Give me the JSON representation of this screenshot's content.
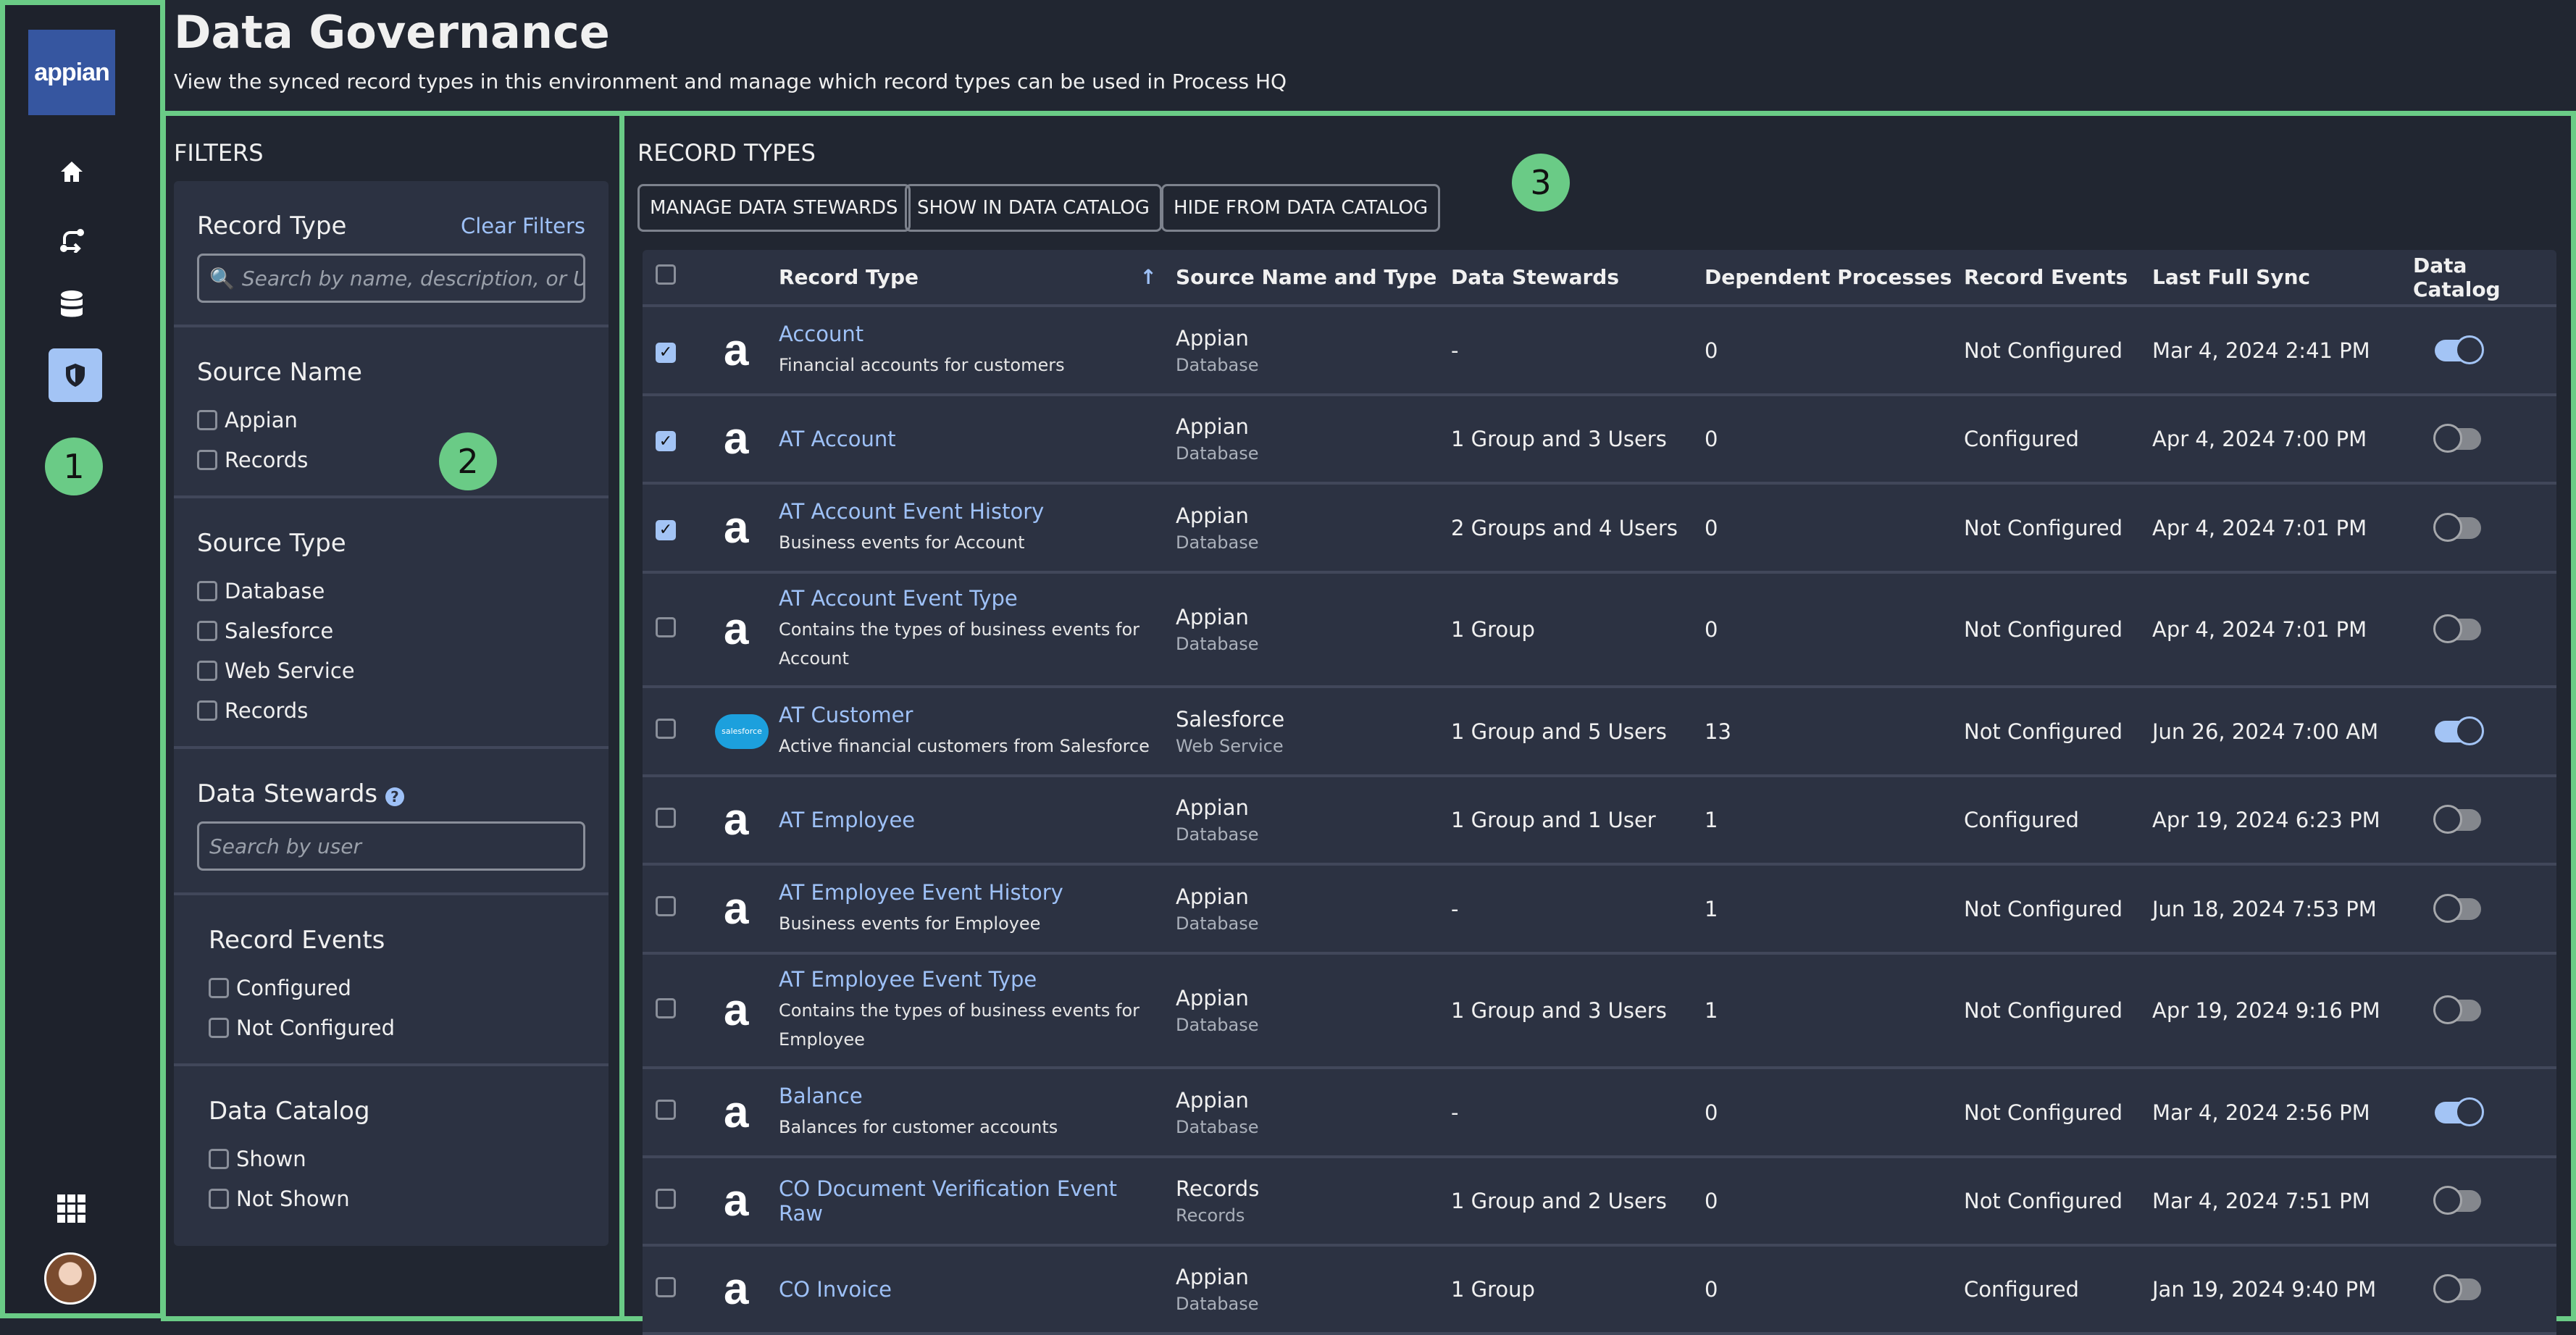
{
  "app": {
    "logo_text": "appian"
  },
  "header": {
    "title": "Data Governance",
    "subtitle": "View the synced record types in this environment and manage which record types can be used in Process HQ"
  },
  "annotations": [
    "1",
    "2",
    "3"
  ],
  "nav": {
    "items": [
      {
        "icon": "home-icon"
      },
      {
        "icon": "process-flow-icon"
      },
      {
        "icon": "database-icon"
      },
      {
        "icon": "shield-icon",
        "active": true
      }
    ],
    "bottom": [
      {
        "icon": "apps-grid-icon"
      },
      {
        "icon": "user-avatar"
      }
    ]
  },
  "filters": {
    "heading": "FILTERS",
    "record_type": {
      "label": "Record Type",
      "clear": "Clear Filters",
      "placeholder": "Search by name, description, or UUID"
    },
    "source_name": {
      "label": "Source Name",
      "options": [
        "Appian",
        "Records"
      ]
    },
    "source_type": {
      "label": "Source Type",
      "options": [
        "Database",
        "Salesforce",
        "Web Service",
        "Records"
      ]
    },
    "data_stewards": {
      "label": "Data Stewards",
      "help": "?",
      "placeholder": "Search by user"
    },
    "record_events": {
      "label": "Record Events",
      "options": [
        "Configured",
        "Not Configured"
      ]
    },
    "data_catalog": {
      "label": "Data Catalog",
      "options": [
        "Shown",
        "Not Shown"
      ]
    }
  },
  "records": {
    "heading": "RECORD TYPES",
    "buttons": [
      "MANAGE DATA STEWARDS",
      "SHOW IN DATA CATALOG",
      "HIDE FROM DATA CATALOG"
    ],
    "columns": [
      "Record Type",
      "Source Name and Type",
      "Data Stewards",
      "Dependent Processes",
      "Record Events",
      "Last Full Sync",
      "Data Catalog"
    ],
    "sort": "ascending",
    "colors": {
      "link": "#9ec1f7",
      "accent": "#a3c4f5",
      "frame": "#6acb86"
    },
    "rows": [
      {
        "selected": true,
        "icon": "appian",
        "name": "Account",
        "description": "Financial accounts for customers",
        "source_name": "Appian",
        "source_type": "Database",
        "stewards": "-",
        "dependent": "0",
        "events": "Not Configured",
        "last_sync": "Mar 4, 2024 2:41 PM",
        "catalog": true
      },
      {
        "selected": true,
        "icon": "appian",
        "name": "AT Account",
        "description": "",
        "source_name": "Appian",
        "source_type": "Database",
        "stewards": "1 Group and 3 Users",
        "dependent": "0",
        "events": "Configured",
        "last_sync": "Apr 4, 2024 7:00 PM",
        "catalog": false
      },
      {
        "selected": true,
        "icon": "appian",
        "name": "AT Account Event History",
        "description": "Business events for Account",
        "source_name": "Appian",
        "source_type": "Database",
        "stewards": "2 Groups and 4 Users",
        "dependent": "0",
        "events": "Not Configured",
        "last_sync": "Apr 4, 2024 7:01 PM",
        "catalog": false
      },
      {
        "selected": false,
        "icon": "appian",
        "name": "AT Account Event Type",
        "description": "Contains the types of business events for Account",
        "source_name": "Appian",
        "source_type": "Database",
        "stewards": "1 Group",
        "dependent": "0",
        "events": "Not Configured",
        "last_sync": "Apr 4, 2024 7:01 PM",
        "catalog": false
      },
      {
        "selected": false,
        "icon": "salesforce",
        "icon_text": "salesforce",
        "name": "AT Customer",
        "description": "Active financial customers from Salesforce",
        "source_name": "Salesforce",
        "source_type": "Web Service",
        "stewards": "1 Group and 5 Users",
        "dependent": "13",
        "events": "Not Configured",
        "last_sync": "Jun 26, 2024 7:00 AM",
        "catalog": true
      },
      {
        "selected": false,
        "icon": "appian",
        "name": "AT Employee",
        "description": "",
        "source_name": "Appian",
        "source_type": "Database",
        "stewards": "1 Group and 1 User",
        "dependent": "1",
        "events": "Configured",
        "last_sync": "Apr 19, 2024 6:23 PM",
        "catalog": false
      },
      {
        "selected": false,
        "icon": "appian",
        "name": "AT Employee Event History",
        "description": "Business events for Employee",
        "source_name": "Appian",
        "source_type": "Database",
        "stewards": "-",
        "dependent": "1",
        "events": "Not Configured",
        "last_sync": "Jun 18, 2024 7:53 PM",
        "catalog": false
      },
      {
        "selected": false,
        "icon": "appian",
        "name": "AT Employee Event Type",
        "description": "Contains the types of business events for Employee",
        "source_name": "Appian",
        "source_type": "Database",
        "stewards": "1 Group and 3 Users",
        "dependent": "1",
        "events": "Not Configured",
        "last_sync": "Apr 19, 2024 9:16 PM",
        "catalog": false
      },
      {
        "selected": false,
        "icon": "appian",
        "name": "Balance",
        "description": "Balances for customer accounts",
        "source_name": "Appian",
        "source_type": "Database",
        "stewards": "-",
        "dependent": "0",
        "events": "Not Configured",
        "last_sync": "Mar 4, 2024 2:56 PM",
        "catalog": true
      },
      {
        "selected": false,
        "icon": "records",
        "name": "CO Document Verification Event Raw",
        "description": "",
        "source_name": "Records",
        "source_type": "Records",
        "stewards": "1 Group and 2 Users",
        "dependent": "0",
        "events": "Not Configured",
        "last_sync": "Mar 4, 2024 7:51 PM",
        "catalog": false
      },
      {
        "selected": false,
        "icon": "appian",
        "name": "CO Invoice",
        "description": "",
        "source_name": "Appian",
        "source_type": "Database",
        "stewards": "1 Group",
        "dependent": "0",
        "events": "Configured",
        "last_sync": "Jan 19, 2024 9:40 PM",
        "catalog": false
      }
    ]
  }
}
